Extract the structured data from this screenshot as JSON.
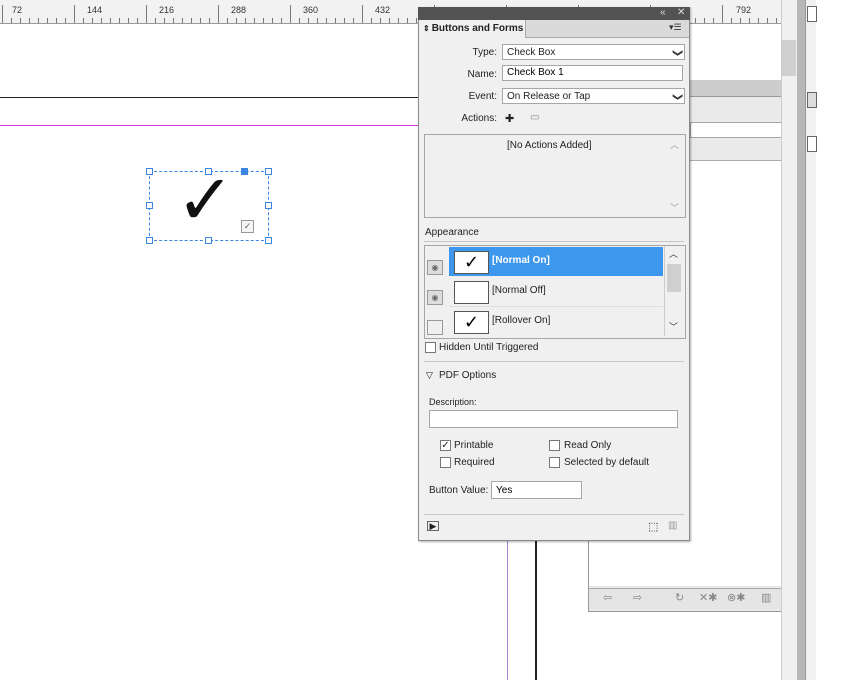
{
  "ruler": {
    "labels": [
      "72",
      "144",
      "216",
      "288",
      "360",
      "432",
      "792"
    ]
  },
  "panel": {
    "title": "Buttons and Forms",
    "type_label": "Type:",
    "type_value": "Check Box",
    "name_label": "Name:",
    "name_value": "Check Box 1",
    "event_label": "Event:",
    "event_value": "On Release or Tap",
    "actions_label": "Actions:",
    "actions_placeholder": "[No Actions Added]",
    "appearance_label": "Appearance",
    "appearance_states": [
      {
        "label": "[Normal On]",
        "checked": true,
        "selected": true
      },
      {
        "label": "[Normal Off]",
        "checked": false,
        "selected": false
      },
      {
        "label": "[Rollover On]",
        "checked": true,
        "selected": false
      }
    ],
    "hidden_until_triggered": "Hidden Until Triggered",
    "pdf_options": "PDF Options",
    "description_label": "Description:",
    "description_value": "",
    "printable": "Printable",
    "printable_checked": true,
    "read_only": "Read Only",
    "required": "Required",
    "selected_by_default": "Selected by default",
    "button_value_label": "Button Value:",
    "button_value": "Yes"
  },
  "icons": {
    "checkmark": "✓",
    "dropdown": "❯",
    "panel_menu": "▾☰",
    "collapse": "«",
    "close": "✕",
    "add_action": "✚",
    "remove_action": "▭",
    "scroll_up": "︿",
    "scroll_down": "﹀",
    "disclosure": "▽",
    "preview": "▶",
    "convert": "⬚",
    "trash": "🗑"
  },
  "colors": {
    "selection": "#3b86e0",
    "highlight_row": "#3d97ec",
    "panel_bg": "#f0f0f0",
    "titlebar": "#535353"
  }
}
